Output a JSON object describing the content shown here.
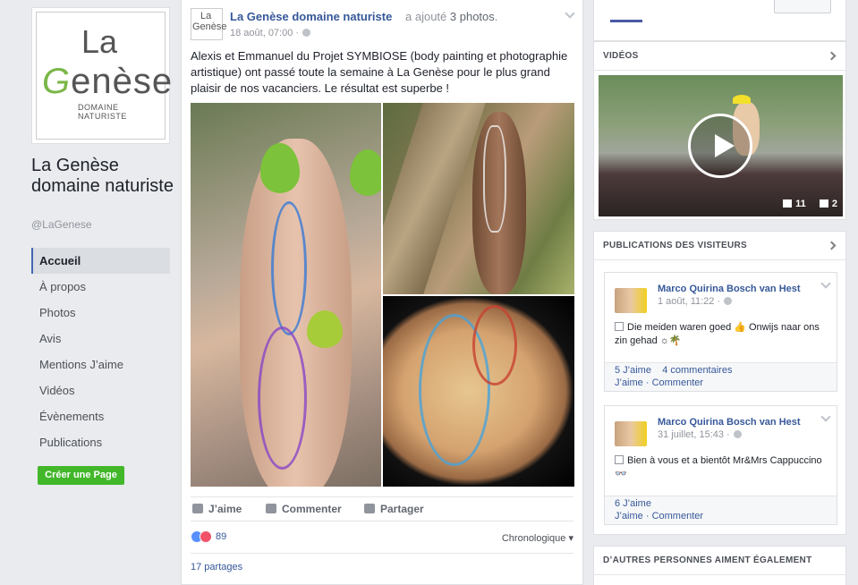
{
  "page": {
    "logo_la": "La",
    "logo_genese": "enèse",
    "logo_g": "G",
    "logo_sub": "DOMAINE NATURISTE",
    "name": "La Genèse domaine naturiste",
    "handle": "@LaGenese"
  },
  "nav": {
    "items": [
      "Accueil",
      "À propos",
      "Photos",
      "Avis",
      "Mentions J’aime",
      "Vidéos",
      "Évènements",
      "Publications"
    ],
    "active": "Accueil"
  },
  "create_page": "Créer une Page",
  "post": {
    "avatar_la": "La",
    "avatar_genese": "Genèse",
    "author": "La Genèse domaine naturiste",
    "action_prefix": "a ajouté",
    "action_link": "3 photos",
    "action_suffix": ".",
    "date": "18 août, 07:00 ·",
    "text": "Alexis et Emmanuel du Projet SYMBIOSE (body painting et photographie artistique) ont passé toute la semaine à La Genèse pour le plus grand plaisir de nos vacanciers. Le résultat est superbe !",
    "like": "J’aime",
    "comment": "Commenter",
    "share": "Partager",
    "reaction_count": "89",
    "sort": "Chronologique ▾",
    "shares": "17 partages"
  },
  "right": {
    "videos_title": "VIDÉOS",
    "video_likes": "11",
    "video_comments": "2",
    "visitors_title": "PUBLICATIONS DES VISITEURS",
    "visitor_posts": [
      {
        "name": "Marco Quirina Bosch van Hest",
        "date": "1 août, 11:22 ·",
        "text": "Die meiden waren goed 👍 Onwijs naar ons zin gehad ☼🌴",
        "likes": "5 J’aime",
        "comments": "4 commentaires",
        "like_link": "J’aime",
        "comment_link": "Commenter"
      },
      {
        "name": "Marco Quirina Bosch van Hest",
        "date": "31 juillet, 15:43 ·",
        "text": "Bien à vous et a bientôt Mr&Mrs Cappuccino 👓",
        "likes": "6 J’aime",
        "comments": "",
        "like_link": "J’aime",
        "comment_link": "Commenter"
      }
    ],
    "others_title": "D’AUTRES PERSONNES AIMENT ÉGALEMENT"
  },
  "colors": {
    "link": "#365899",
    "green": "#42b72a",
    "bg": "#e9ebee"
  }
}
